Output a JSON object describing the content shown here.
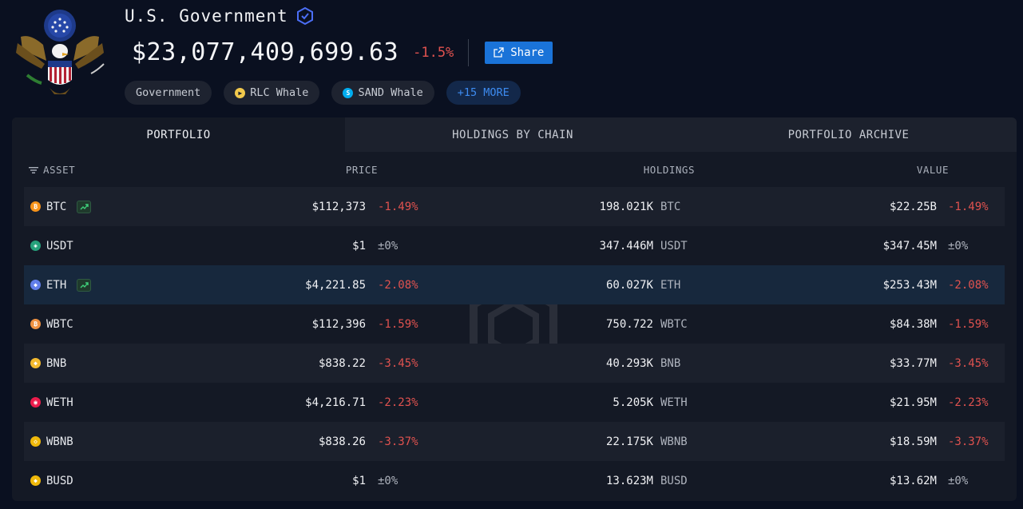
{
  "header": {
    "entity_name": "U.S. Government",
    "total_value": "$23,077,409,699.63",
    "total_change": "-1.5%",
    "share_label": "Share",
    "tags": [
      {
        "label": "Government",
        "icon": "none"
      },
      {
        "label": "RLC Whale",
        "icon": "rlc-icon"
      },
      {
        "label": "SAND Whale",
        "icon": "sand-icon"
      },
      {
        "label": "+15 MORE",
        "icon": "none"
      }
    ]
  },
  "tabs": [
    {
      "label": "PORTFOLIO",
      "active": true
    },
    {
      "label": "HOLDINGS BY CHAIN",
      "active": false
    },
    {
      "label": "PORTFOLIO ARCHIVE",
      "active": false
    }
  ],
  "table": {
    "headers": {
      "asset": "ASSET",
      "price": "PRICE",
      "holdings": "HOLDINGS",
      "value": "VALUE"
    },
    "rows": [
      {
        "asset": "BTC",
        "icon": "btc-icon",
        "coin_color": "#f7931a",
        "trend": true,
        "price": "$112,373",
        "price_change": "-1.49%",
        "holdings": "198.021K",
        "symbol": "BTC",
        "value": "$22.25B",
        "value_change": "-1.49%"
      },
      {
        "asset": "USDT",
        "icon": "usdt-icon",
        "coin_color": "#26a17b",
        "trend": false,
        "price": "$1",
        "price_change": "±0%",
        "holdings": "347.446M",
        "symbol": "USDT",
        "value": "$347.45M",
        "value_change": "±0%"
      },
      {
        "asset": "ETH",
        "icon": "eth-icon",
        "coin_color": "#627eea",
        "trend": true,
        "price": "$4,221.85",
        "price_change": "-2.08%",
        "holdings": "60.027K",
        "symbol": "ETH",
        "value": "$253.43M",
        "value_change": "-2.08%"
      },
      {
        "asset": "WBTC",
        "icon": "wbtc-icon",
        "coin_color": "#f09242",
        "trend": false,
        "price": "$112,396",
        "price_change": "-1.59%",
        "holdings": "750.722",
        "symbol": "WBTC",
        "value": "$84.38M",
        "value_change": "-1.59%"
      },
      {
        "asset": "BNB",
        "icon": "bnb-icon",
        "coin_color": "#f3ba2f",
        "trend": false,
        "price": "$838.22",
        "price_change": "-3.45%",
        "holdings": "40.293K",
        "symbol": "BNB",
        "value": "$33.77M",
        "value_change": "-3.45%"
      },
      {
        "asset": "WETH",
        "icon": "weth-icon",
        "coin_color": "#ec1c4c",
        "trend": false,
        "price": "$4,216.71",
        "price_change": "-2.23%",
        "holdings": "5.205K",
        "symbol": "WETH",
        "value": "$21.95M",
        "value_change": "-2.23%"
      },
      {
        "asset": "WBNB",
        "icon": "wbnb-icon",
        "coin_color": "#f0b90b",
        "trend": false,
        "price": "$838.26",
        "price_change": "-3.37%",
        "holdings": "22.175K",
        "symbol": "WBNB",
        "value": "$18.59M",
        "value_change": "-3.37%"
      },
      {
        "asset": "BUSD",
        "icon": "busd-icon",
        "coin_color": "#f0b90b",
        "trend": false,
        "price": "$1",
        "price_change": "±0%",
        "holdings": "13.623M",
        "symbol": "BUSD",
        "value": "$13.62M",
        "value_change": "±0%"
      }
    ]
  },
  "colors": {
    "accent": "#1a73d8",
    "negative": "#e0524f",
    "more_tag": "#3d8bf0"
  }
}
